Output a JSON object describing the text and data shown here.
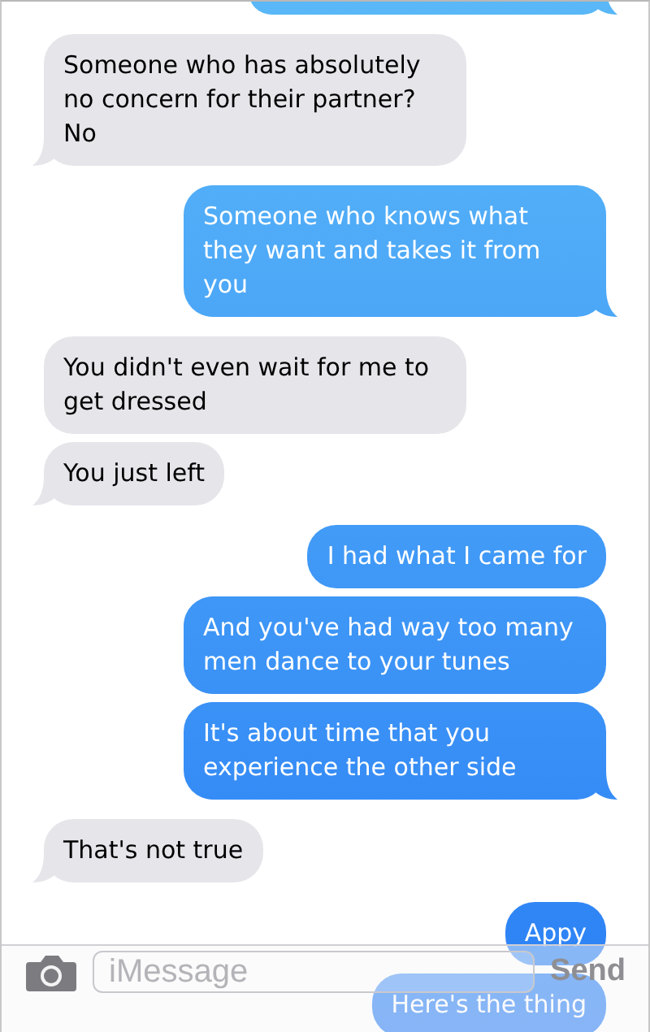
{
  "partial_top_message": {
    "kind": "sent"
  },
  "messages": [
    {
      "kind": "received",
      "text": "Someone who has absolutely no concern for their partner? No"
    },
    {
      "kind": "sent",
      "text": "Someone who knows what they want and takes it from you"
    },
    {
      "kind": "received",
      "text": "You didn't even wait for me to get dressed"
    },
    {
      "kind": "received",
      "text": "You just left"
    },
    {
      "kind": "sent",
      "text": "I had what I came for"
    },
    {
      "kind": "sent",
      "text": "And you've had way too many men dance to your tunes"
    },
    {
      "kind": "sent",
      "text": "It's about time that you experience the other side"
    },
    {
      "kind": "received",
      "text": "That's not true"
    },
    {
      "kind": "sent",
      "text": "Appy"
    },
    {
      "kind": "sent",
      "text": "Here's the thing"
    }
  ],
  "composer": {
    "placeholder": "iMessage",
    "send": "Send"
  }
}
